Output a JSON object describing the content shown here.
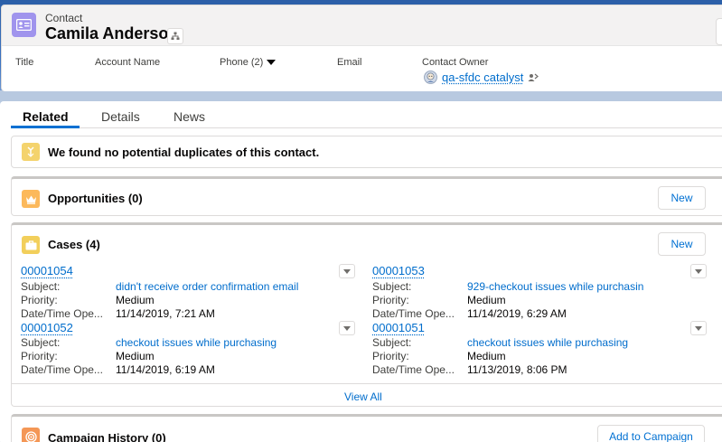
{
  "header": {
    "entity_label": "Contact",
    "record_name": "Camila Anderson",
    "fields": {
      "title": "Title",
      "account_name": "Account Name",
      "phone": "Phone (2)",
      "email": "Email",
      "contact_owner_label": "Contact Owner",
      "contact_owner_value": "qa-sfdc catalyst"
    }
  },
  "tabs": [
    {
      "label": "Related",
      "active": true
    },
    {
      "label": "Details",
      "active": false
    },
    {
      "label": "News",
      "active": false
    }
  ],
  "duplicates": {
    "message": "We found no potential duplicates of this contact."
  },
  "opportunities": {
    "title": "Opportunities (0)",
    "new_label": "New"
  },
  "cases": {
    "title": "Cases (4)",
    "new_label": "New",
    "labels": {
      "subject": "Subject:",
      "priority": "Priority:",
      "datetime": "Date/Time Ope..."
    },
    "items": [
      {
        "number": "00001054",
        "subject": "didn't receive order confirmation email",
        "priority": "Medium",
        "opened": "11/14/2019, 7:21 AM"
      },
      {
        "number": "00001053",
        "subject": "929-checkout issues while purchasin",
        "priority": "Medium",
        "opened": "11/14/2019, 6:29 AM"
      },
      {
        "number": "00001052",
        "subject": "checkout issues while purchasing",
        "priority": "Medium",
        "opened": "11/14/2019, 6:19 AM"
      },
      {
        "number": "00001051",
        "subject": "checkout issues while purchasing",
        "priority": "Medium",
        "opened": "11/13/2019, 8:06 PM"
      }
    ],
    "view_all": "View All"
  },
  "campaign_history": {
    "title": "Campaign History (0)",
    "add_label": "Add to Campaign"
  },
  "colors": {
    "brand_blue": "#0070d2",
    "link": "#006dcc",
    "contact_icon": "#a094ed",
    "duplicate_icon": "#f4d36d",
    "opportunity_icon": "#fcb95b",
    "case_icon": "#f2cf5b",
    "campaign_icon": "#f49756"
  },
  "icons": {
    "contact": "contact-card-icon",
    "hierarchy": "hierarchy-icon",
    "owner_avatar": "astro-avatar-icon",
    "change_owner": "change-owner-icon",
    "duplicate": "merge-icon",
    "opportunity": "crown-icon",
    "case": "briefcase-icon",
    "campaign": "target-icon"
  }
}
